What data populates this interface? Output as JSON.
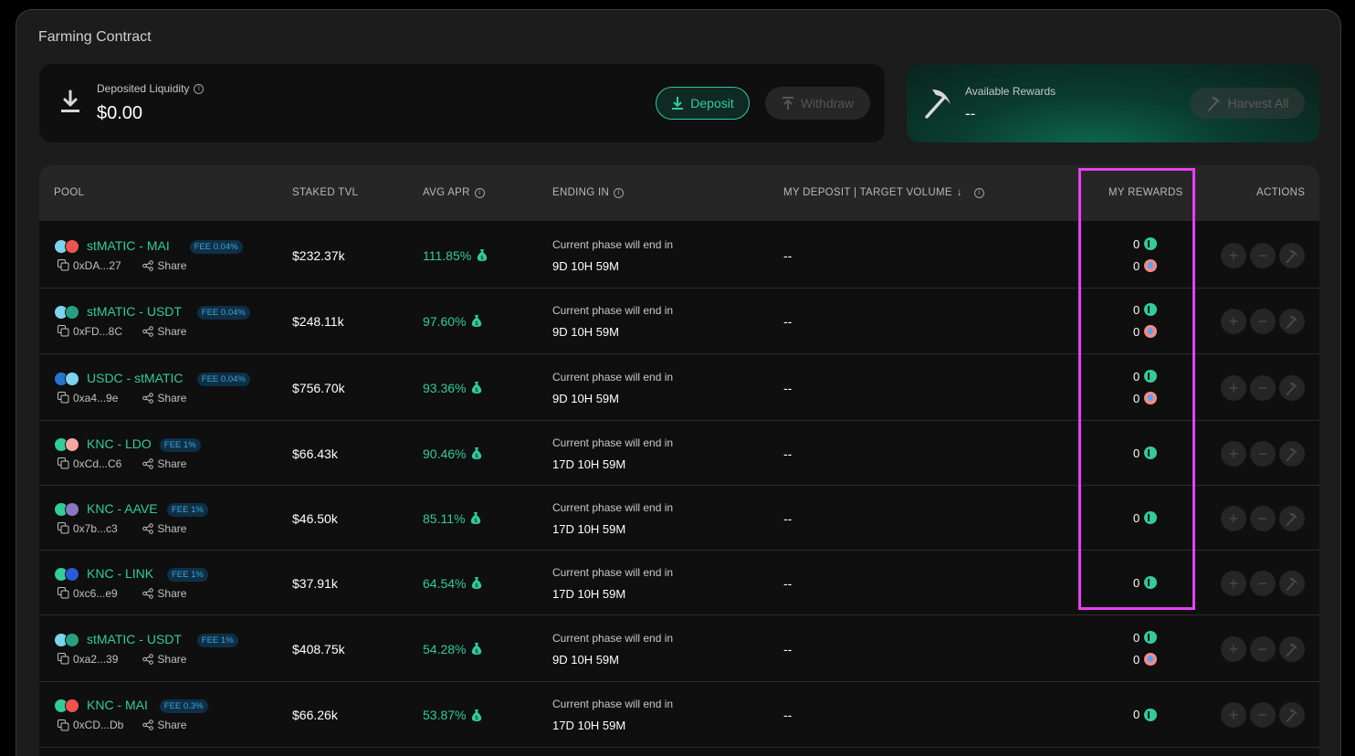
{
  "header": {
    "title": "Farming Contract"
  },
  "deposit": {
    "label": "Deposited Liquidity",
    "value": "$0.00",
    "deposit_label": "Deposit",
    "withdraw_label": "Withdraw"
  },
  "rewards": {
    "label": "Available Rewards",
    "value": "--",
    "harvest_label": "Harvest All"
  },
  "colors": {
    "accent": "#31cb9e",
    "highlight": "#e83ff0",
    "fee": "#3aa7e0"
  },
  "table": {
    "headers": {
      "pool": "POOL",
      "tvl": "STAKED TVL",
      "apr": "AVG APR",
      "ending": "ENDING IN",
      "deposit": "MY DEPOSIT | TARGET VOLUME",
      "rewards": "MY REWARDS",
      "actions": "ACTIONS"
    },
    "rows": [
      {
        "pair": "stMATIC - MAI",
        "fee": "FEE 0.04%",
        "addr": "0xDA...27",
        "share": "Share",
        "tvl": "$232.37k",
        "apr": "111.85%",
        "end_label": "Current phase will end in",
        "end_value": "9D 10H 59M",
        "my_deposit": "--",
        "rewards": [
          "0",
          "0"
        ]
      },
      {
        "pair": "stMATIC - USDT",
        "fee": "FEE 0.04%",
        "addr": "0xFD...8C",
        "share": "Share",
        "tvl": "$248.11k",
        "apr": "97.60%",
        "end_label": "Current phase will end in",
        "end_value": "9D 10H 59M",
        "my_deposit": "--",
        "rewards": [
          "0",
          "0"
        ]
      },
      {
        "pair": "USDC - stMATIC",
        "fee": "FEE 0.04%",
        "addr": "0xa4...9e",
        "share": "Share",
        "tvl": "$756.70k",
        "apr": "93.36%",
        "end_label": "Current phase will end in",
        "end_value": "9D 10H 59M",
        "my_deposit": "--",
        "rewards": [
          "0",
          "0"
        ]
      },
      {
        "pair": "KNC - LDO",
        "fee": "FEE 1%",
        "addr": "0xCd...C6",
        "share": "Share",
        "tvl": "$66.43k",
        "apr": "90.46%",
        "end_label": "Current phase will end in",
        "end_value": "17D 10H 59M",
        "my_deposit": "--",
        "rewards": [
          "0"
        ]
      },
      {
        "pair": "KNC - AAVE",
        "fee": "FEE 1%",
        "addr": "0x7b...c3",
        "share": "Share",
        "tvl": "$46.50k",
        "apr": "85.11%",
        "end_label": "Current phase will end in",
        "end_value": "17D 10H 59M",
        "my_deposit": "--",
        "rewards": [
          "0"
        ]
      },
      {
        "pair": "KNC - LINK",
        "fee": "FEE 1%",
        "addr": "0xc6...e9",
        "share": "Share",
        "tvl": "$37.91k",
        "apr": "64.54%",
        "end_label": "Current phase will end in",
        "end_value": "17D 10H 59M",
        "my_deposit": "--",
        "rewards": [
          "0"
        ]
      },
      {
        "pair": "stMATIC - USDT",
        "fee": "FEE 1%",
        "addr": "0xa2...39",
        "share": "Share",
        "tvl": "$408.75k",
        "apr": "54.28%",
        "end_label": "Current phase will end in",
        "end_value": "9D 10H 59M",
        "my_deposit": "--",
        "rewards": [
          "0",
          "0"
        ]
      },
      {
        "pair": "KNC - MAI",
        "fee": "FEE 0.3%",
        "addr": "0xCD...Db",
        "share": "Share",
        "tvl": "$66.26k",
        "apr": "53.87%",
        "end_label": "Current phase will end in",
        "end_value": "17D 10H 59M",
        "my_deposit": "--",
        "rewards": [
          "0"
        ]
      }
    ]
  }
}
